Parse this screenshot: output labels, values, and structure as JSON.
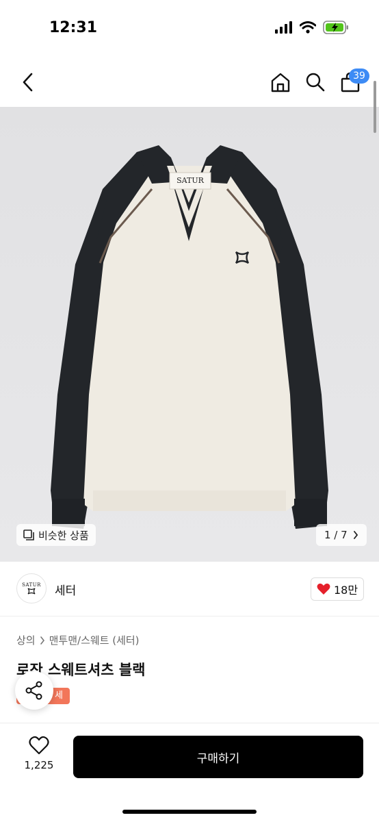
{
  "status_bar": {
    "time": "12:31"
  },
  "nav": {
    "cart_count": "39"
  },
  "image": {
    "brand_label": "SATUR",
    "similar_label": "비슷한 상품",
    "page_indicator": "1 / 7"
  },
  "brand": {
    "logo_text": "SATUR",
    "name": "세터",
    "likes": "18만"
  },
  "product": {
    "breadcrumb_category": "상의",
    "breadcrumb_sub": "맨투맨/스웨트 (세터)",
    "title": "로잔 스웨트셔츠 블랙",
    "sale_tag": "세일"
  },
  "bottom": {
    "wish_count": "1,225",
    "buy_label": "구매하기"
  },
  "colors": {
    "accent_blue": "#3d8bf5",
    "battery_green": "#52c41a",
    "heart_red": "#e5202b",
    "sale_orange": "#f2765a",
    "sweater_cream": "#efebe2",
    "sweater_black": "#23262a"
  }
}
